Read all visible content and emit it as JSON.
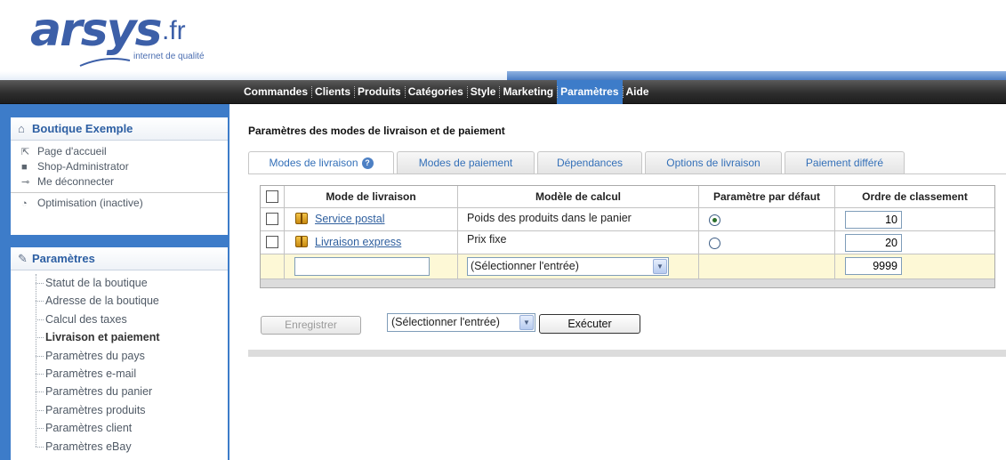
{
  "brand": {
    "logo_word": "arsys",
    "logo_tld": ".fr",
    "tagline": "internet de qualité",
    "accent_color": "#3d7cc9",
    "logo_color": "#3c5fa8"
  },
  "main_nav": {
    "items": [
      {
        "label": "Commandes"
      },
      {
        "label": "Clients"
      },
      {
        "label": "Produits"
      },
      {
        "label": "Catégories"
      },
      {
        "label": "Style"
      },
      {
        "label": "Marketing"
      },
      {
        "label": "Paramètres",
        "active": true
      },
      {
        "label": "Aide"
      }
    ]
  },
  "sidebar": {
    "shop": {
      "title": "Boutique Exemple",
      "title_icon": "home-icon",
      "links": [
        {
          "label": "Page d'accueil",
          "icon": "signpost-icon"
        },
        {
          "label": "Shop-Administrator",
          "icon": "user-icon"
        },
        {
          "label": "Me déconnecter",
          "icon": "key-icon"
        }
      ],
      "optimisation": {
        "label": "Optimisation (inactive)",
        "icon": "speedometer-icon"
      }
    },
    "settings": {
      "title": "Paramètres",
      "title_icon": "wrench-icon",
      "items": [
        {
          "label": "Statut de la boutique"
        },
        {
          "label": "Adresse de la boutique"
        },
        {
          "label": "Calcul des taxes"
        },
        {
          "label": "Livraison et paiement",
          "current": true
        },
        {
          "label": "Paramètres du pays"
        },
        {
          "label": "Paramètres e-mail"
        },
        {
          "label": "Paramètres du panier"
        },
        {
          "label": "Paramètres produits"
        },
        {
          "label": "Paramètres client"
        },
        {
          "label": "Paramètres eBay"
        }
      ]
    }
  },
  "content": {
    "title": "Paramètres des modes de livraison et de paiement",
    "tabs": [
      {
        "label": "Modes de livraison",
        "active": true,
        "has_help": true
      },
      {
        "label": "Modes de paiement"
      },
      {
        "label": "Dépendances"
      },
      {
        "label": "Options de livraison"
      },
      {
        "label": "Paiement différé"
      }
    ],
    "help_glyph": "?",
    "table": {
      "headers": [
        "Mode de livraison",
        "Modèle de calcul",
        "Paramètre par défaut",
        "Ordre de classement"
      ],
      "rows": [
        {
          "mode": "Service postal",
          "calc": "Poids des produits dans le panier",
          "default": true,
          "order": "10"
        },
        {
          "mode": "Livraison express",
          "calc": "Prix fixe",
          "default": false,
          "order": "20"
        }
      ],
      "new_row": {
        "mode_value": "",
        "calc_select": "(Sélectionner l'entrée)",
        "order": "9999"
      }
    },
    "actions": {
      "save_label": "Enregistrer",
      "select_value": "(Sélectionner l'entrée)",
      "execute_label": "Exécuter"
    },
    "dropdown_glyph": "▼"
  }
}
